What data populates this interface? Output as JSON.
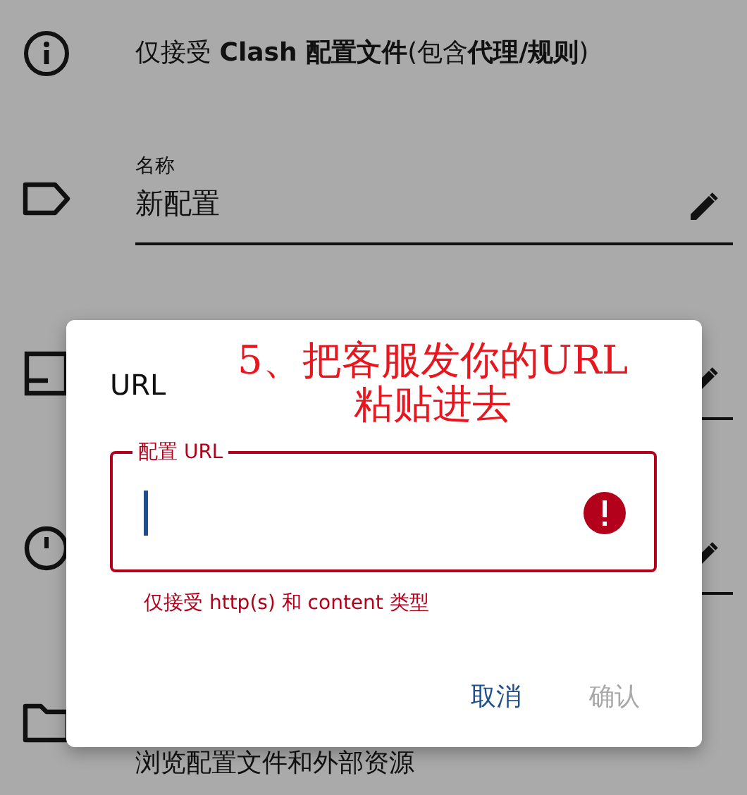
{
  "info": {
    "text": "仅接受 **Clash 配置文件**(包含**代理/规则**)"
  },
  "rows": [
    {
      "kind": "field",
      "label": "名称",
      "value": "新配置"
    },
    {
      "kind": "field"
    },
    {
      "kind": "field"
    },
    {
      "kind": "link",
      "summary": "浏览配置文件和外部资源"
    }
  ],
  "dialog": {
    "title": "URL",
    "field": {
      "label": "配置 URL",
      "error": true,
      "helper": "仅接受 http(s) 和 content 类型"
    },
    "buttons": [
      {
        "label": "取消",
        "disabled": false
      },
      {
        "label": "确认",
        "disabled": true
      }
    ]
  },
  "annotation": {
    "lines": [
      "5、把客服发你的URL",
      "粘贴进去"
    ]
  }
}
